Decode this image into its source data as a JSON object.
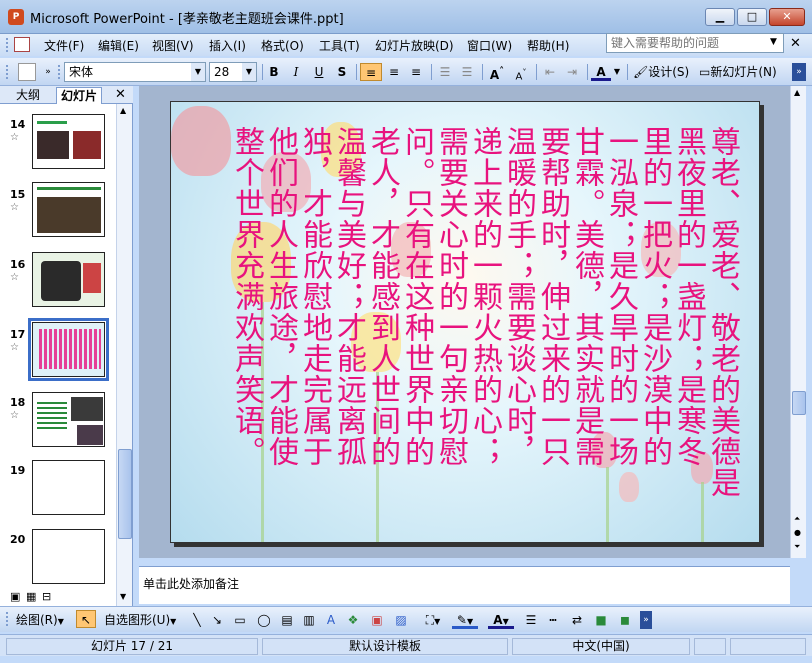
{
  "window": {
    "title": "Microsoft PowerPoint - [孝亲敬老主题班会课件.ppt]"
  },
  "menubar": {
    "items": [
      "文件(F)",
      "编辑(E)",
      "视图(V)",
      "插入(I)",
      "格式(O)",
      "工具(T)",
      "幻灯片放映(D)",
      "窗口(W)",
      "帮助(H)"
    ],
    "help_placeholder": "键入需要帮助的问题"
  },
  "toolbar": {
    "font_name": "宋体",
    "font_size": "28",
    "bold": "B",
    "italic": "I",
    "underline": "U",
    "shadow": "S",
    "design_label": "设计(S)",
    "new_slide_label": "新幻灯片(N)"
  },
  "left_panel": {
    "tabs": [
      "大纲",
      "幻灯片"
    ],
    "active_tab": "幻灯片",
    "thumbnails": [
      {
        "num": "14"
      },
      {
        "num": "15"
      },
      {
        "num": "16"
      },
      {
        "num": "17",
        "selected": true
      },
      {
        "num": "18"
      },
      {
        "num": "19"
      },
      {
        "num": "20"
      }
    ]
  },
  "slide": {
    "columns": [
      "尊老、爱老、敬老的美德是",
      "黑夜里的一盏灯；是寒冬",
      "里的一把火；是沙漠中的",
      "一泓泉；是久旱时的一场",
      "甘霖。美德，其实就是需",
      "要帮助时，伸过来的一只",
      "温暖的手；需要谈心时，",
      "递上来的一颗火热的心；",
      "需要关心时的一句亲切慰",
      "问。只有在这种世界中的",
      "老人，才能感到人世间的",
      "温馨与美好；才能远离孤",
      "独，才能欣慰地走完属于",
      "他们的人生旅途，才能使",
      "整个世界充满欢声笑语。"
    ],
    "text_color": "#e8137e"
  },
  "notes": {
    "placeholder": "单击此处添加备注"
  },
  "drawbar": {
    "draw_label": "绘图(R)",
    "autoshape_label": "自选图形(U)"
  },
  "statusbar": {
    "slide_pos": "幻灯片 17 / 21",
    "template": "默认设计模板",
    "language": "中文(中国)"
  }
}
